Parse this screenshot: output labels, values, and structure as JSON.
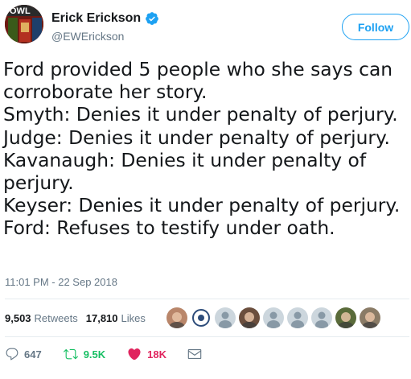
{
  "author": {
    "name": "Erick Erickson",
    "handle": "@EWErickson",
    "verified": true,
    "avatar_badge": "OWL"
  },
  "follow_button": {
    "label": "Follow"
  },
  "tweet": {
    "lines": [
      "Ford provided 5 people who she says can",
      "corroborate her story.",
      "Smyth: Denies it under penalty of perjury.",
      "Judge: Denies it under penalty of perjury.",
      "Kavanaugh: Denies it under penalty of",
      "perjury.",
      "Keyser: Denies it under penalty of perjury.",
      "Ford: Refuses to testify under oath."
    ],
    "timestamp": "11:01 PM - 22 Sep 2018"
  },
  "stats": {
    "retweets_count": "9,503",
    "retweets_label": "Retweets",
    "likes_count": "17,810",
    "likes_label": "Likes"
  },
  "likers": [
    {
      "kind": "photo",
      "color": "#b9866a"
    },
    {
      "kind": "logo",
      "color": "#2d4c7a"
    },
    {
      "kind": "default",
      "color": "#c4cfd6"
    },
    {
      "kind": "photo",
      "color": "#6b4e3d"
    },
    {
      "kind": "default",
      "color": "#c4cfd6"
    },
    {
      "kind": "default",
      "color": "#c4cfd6"
    },
    {
      "kind": "default",
      "color": "#c4cfd6"
    },
    {
      "kind": "photo",
      "color": "#5a6b3a"
    },
    {
      "kind": "photo",
      "color": "#8a7b66"
    }
  ],
  "actions": {
    "reply_count": "647",
    "retweet_count": "9.5K",
    "like_count": "18K"
  },
  "colors": {
    "accent": "#1da1f2",
    "retweet": "#17bf63",
    "like": "#e0245e",
    "muted": "#657786"
  }
}
